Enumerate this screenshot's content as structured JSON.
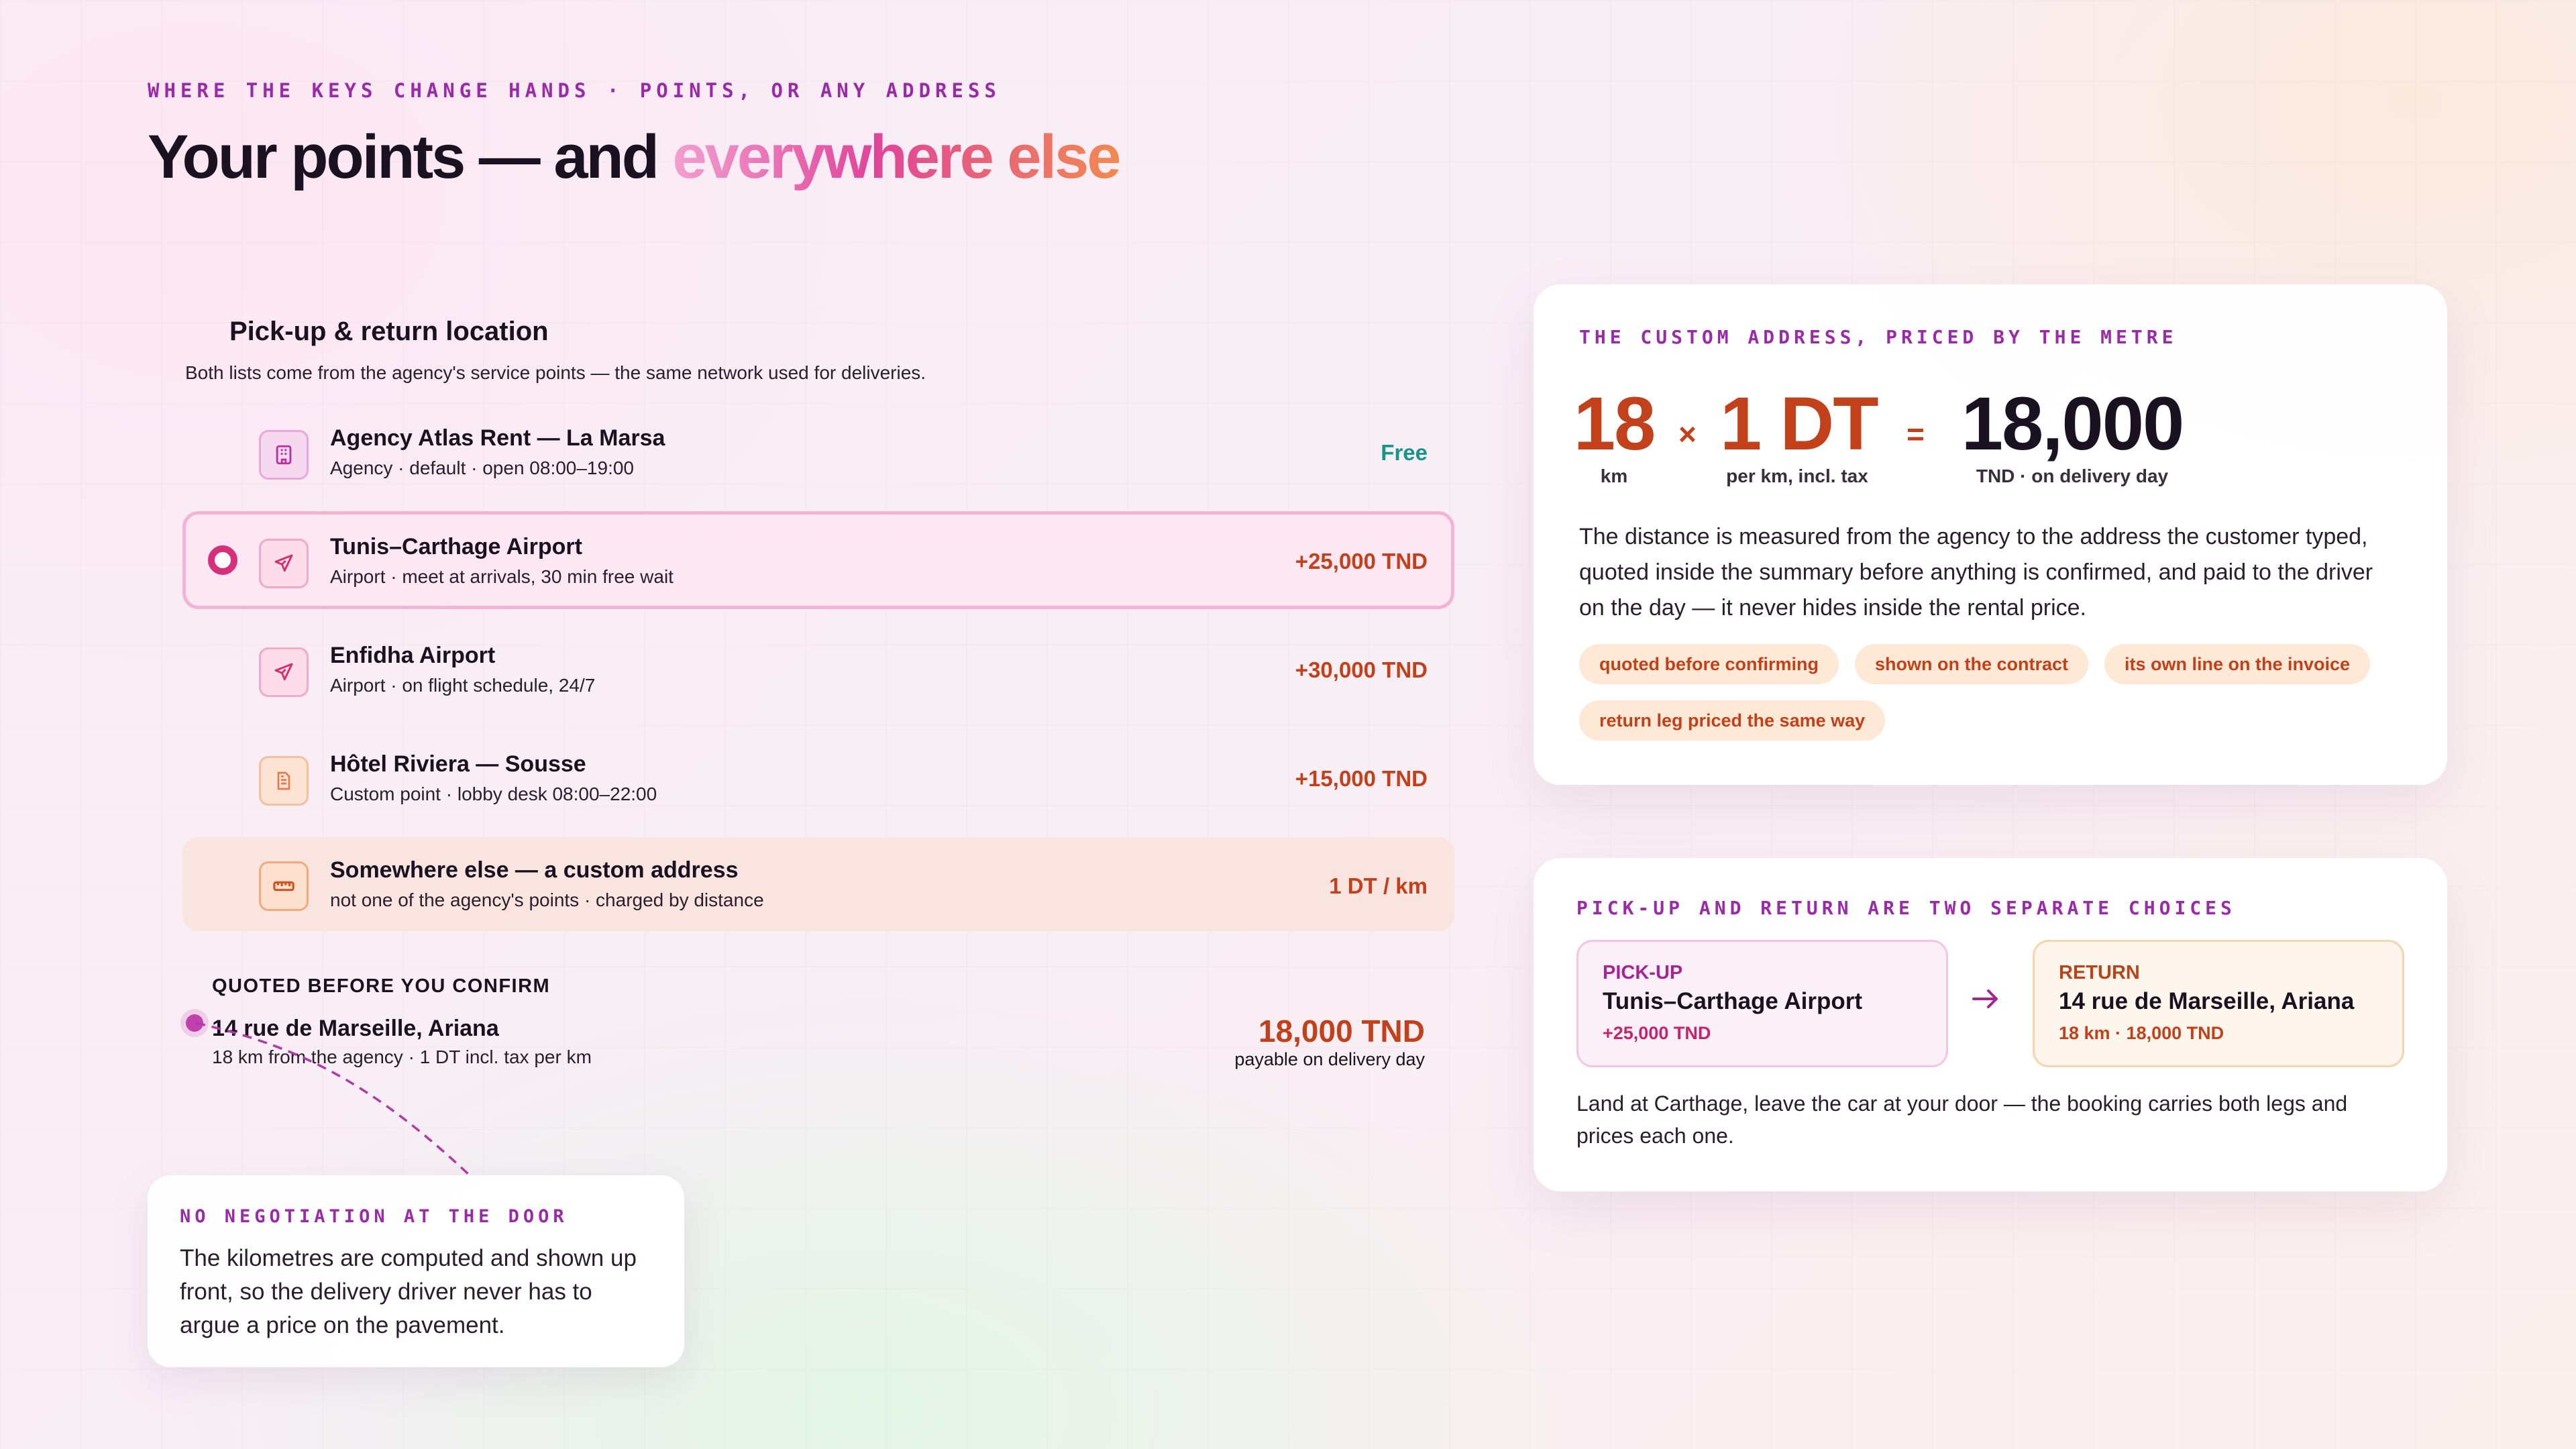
{
  "header": {
    "eyebrow": "WHERE THE KEYS CHANGE HANDS · POINTS, OR ANY ADDRESS",
    "title_plain": "Your points — and ",
    "title_accent": "everywhere else"
  },
  "location_picker": {
    "title": "Pick-up & return location",
    "subtitle": "Both lists come from the agency's service points — the same network used for deliveries.",
    "items": [
      {
        "name": "Agency Atlas Rent — La Marsa",
        "meta": "Agency · default · open 08:00–19:00",
        "price": "Free",
        "icon": "building-icon",
        "selected": false
      },
      {
        "name": "Tunis–Carthage Airport",
        "meta": "Airport · meet at arrivals, 30 min free wait",
        "price": "+25,000 TND",
        "icon": "plane-icon",
        "selected": true
      },
      {
        "name": "Enfidha Airport",
        "meta": "Airport · on flight schedule, 24/7",
        "price": "+30,000 TND",
        "icon": "plane-icon",
        "selected": false
      },
      {
        "name": "Hôtel Riviera — Sousse",
        "meta": "Custom point · lobby desk 08:00–22:00",
        "price": "+15,000 TND",
        "icon": "document-icon",
        "selected": false
      },
      {
        "name": "Somewhere else — a custom address",
        "meta": "not one of the agency's points · charged by distance",
        "price": "1 DT / km",
        "icon": "ruler-icon",
        "selected": false
      }
    ]
  },
  "quote": {
    "eyebrow": "QUOTED BEFORE YOU CONFIRM",
    "address": "14 rue de Marseille, Ariana",
    "meta": "18 km from the agency · 1 DT incl. tax per km",
    "total": "18,000 TND",
    "total_note": "payable on delivery day"
  },
  "callout": {
    "eyebrow": "NO NEGOTIATION AT THE DOOR",
    "body": "The kilometres are computed and shown up front, so the delivery driver never has to argue a price on the pavement."
  },
  "pricing_card": {
    "eyebrow": "THE CUSTOM ADDRESS, PRICED BY THE METRE",
    "distance_value": "18",
    "distance_unit": "km",
    "multiply_sign": "×",
    "rate_value": "1 DT",
    "rate_unit": "per km, incl. tax",
    "equals_sign": "=",
    "total_value": "18,000",
    "total_unit": "TND · on delivery day",
    "description": "The distance is measured from the agency to the address the customer typed, quoted inside the summary before anything is confirmed, and paid to the driver on the day — it never hides inside the rental price.",
    "tags": [
      "quoted before confirming",
      "shown on the contract",
      "its own line on the invoice",
      "return leg priced the same way"
    ]
  },
  "legs_card": {
    "eyebrow": "PICK-UP AND RETURN ARE TWO SEPARATE CHOICES",
    "pickup": {
      "label": "PICK-UP",
      "place": "Tunis–Carthage Airport",
      "price": "+25,000 TND"
    },
    "return": {
      "label": "RETURN",
      "place": "14 rue de Marseille, Ariana",
      "price": "18 km · 18,000 TND"
    },
    "note": "Land at Carthage, leave the car at your door — the booking carries both legs and prices each one."
  },
  "colors": {
    "accent_purple": "#9b2aa8",
    "accent_pink": "#d62f7c",
    "price_orange": "#c2411a",
    "free_teal": "#17958a"
  }
}
